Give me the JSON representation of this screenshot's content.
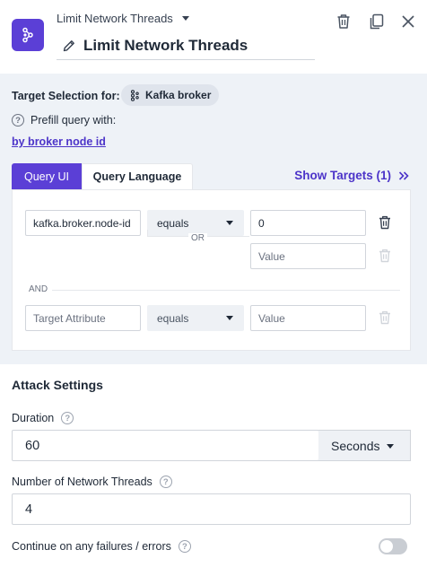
{
  "header": {
    "action_dropdown_label": "Limit Network Threads",
    "title": "Limit Network Threads",
    "icons": [
      "kubernetes-like-logo-icon",
      "trash-icon",
      "copy-icon",
      "close-icon"
    ]
  },
  "targets": {
    "selection_label": "Target Selection for:",
    "target_type": "Kafka broker",
    "prefill_label": "Prefill query with:",
    "prefill_link": "by broker node id",
    "tabs": [
      {
        "label": "Query UI",
        "active": true
      },
      {
        "label": "Query Language",
        "active": false
      }
    ],
    "show_targets_label": "Show Targets (1)",
    "or_label": "OR",
    "and_label": "AND",
    "rows": [
      {
        "attribute": "kafka.broker.node-id",
        "operator": "equals",
        "value": "0"
      },
      {
        "or_value_placeholder": "Value"
      },
      {
        "attribute_placeholder": "Target Attribute",
        "operator": "equals",
        "value_placeholder": "Value"
      }
    ]
  },
  "attack": {
    "section_title": "Attack Settings",
    "duration_label": "Duration",
    "duration_value": "60",
    "duration_unit": "Seconds",
    "threads_label": "Number of Network Threads",
    "threads_value": "4",
    "continue_label": "Continue on any failures / errors",
    "continue_enabled": false
  },
  "colors": {
    "accent": "#5b3fd6",
    "link": "#4c34c9",
    "section_bg": "#eef2f7"
  }
}
